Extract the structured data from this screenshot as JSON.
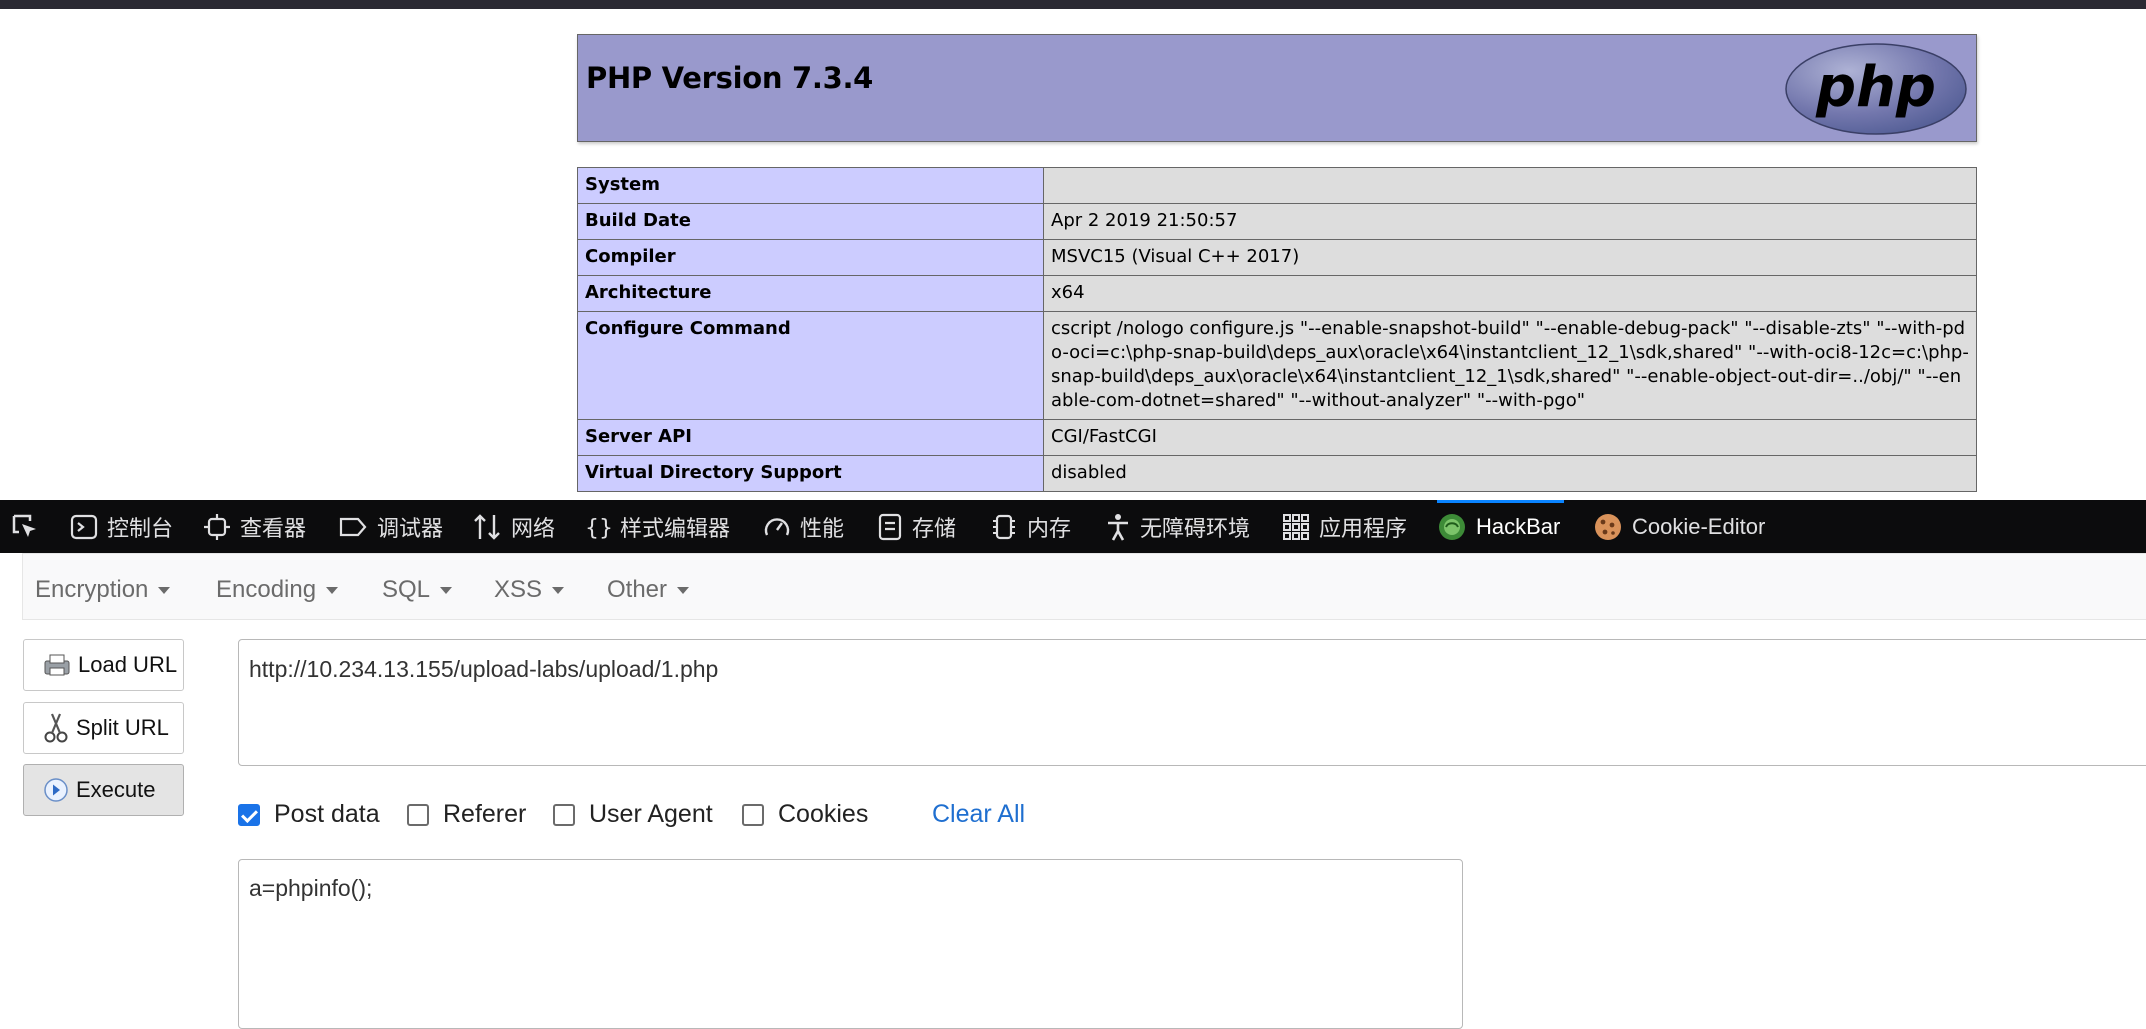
{
  "php": {
    "title": "PHP Version 7.3.4",
    "logo_text": "php",
    "rows": [
      {
        "key": "System",
        "value": ""
      },
      {
        "key": "Build Date",
        "value": "Apr 2 2019 21:50:57"
      },
      {
        "key": "Compiler",
        "value": "MSVC15 (Visual C++ 2017)"
      },
      {
        "key": "Architecture",
        "value": "x64"
      },
      {
        "key": "Configure Command",
        "value": "cscript /nologo configure.js \"--enable-snapshot-build\" \"--enable-debug-pack\" \"--disable-zts\" \"--with-pdo-oci=c:\\php-snap-build\\deps_aux\\oracle\\x64\\instantclient_12_1\\sdk,shared\" \"--with-oci8-12c=c:\\php-snap-build\\deps_aux\\oracle\\x64\\instantclient_12_1\\sdk,shared\" \"--enable-object-out-dir=../obj/\" \"--enable-com-dotnet=shared\" \"--without-analyzer\" \"--with-pgo\""
      },
      {
        "key": "Server API",
        "value": "CGI/FastCGI"
      },
      {
        "key": "Virtual Directory Support",
        "value": "disabled"
      }
    ]
  },
  "devtools": {
    "tabs": [
      {
        "label": "控制台",
        "icon": "console-icon"
      },
      {
        "label": "查看器",
        "icon": "inspector-icon"
      },
      {
        "label": "调试器",
        "icon": "debugger-icon"
      },
      {
        "label": "网络",
        "icon": "network-icon"
      },
      {
        "label": "样式编辑器",
        "icon": "style-editor-icon"
      },
      {
        "label": "性能",
        "icon": "performance-icon"
      },
      {
        "label": "存储",
        "icon": "storage-icon"
      },
      {
        "label": "内存",
        "icon": "memory-icon"
      },
      {
        "label": "无障碍环境",
        "icon": "accessibility-icon"
      },
      {
        "label": "应用程序",
        "icon": "application-icon"
      },
      {
        "label": "HackBar",
        "icon": "hackbar-icon"
      },
      {
        "label": "Cookie-Editor",
        "icon": "cookie-icon"
      }
    ],
    "active_tab": "HackBar",
    "accent": "#0a84ff"
  },
  "hackbar": {
    "menu": [
      "Encryption",
      "Encoding",
      "SQL",
      "XSS",
      "Other"
    ],
    "load_url": "Load URL",
    "split_url": "Split URL",
    "execute": "Execute",
    "url": "http://10.234.13.155/upload-labs/upload/1.php",
    "options": [
      {
        "label": "Post data",
        "checked": true
      },
      {
        "label": "Referer",
        "checked": false
      },
      {
        "label": "User Agent",
        "checked": false
      },
      {
        "label": "Cookies",
        "checked": false
      }
    ],
    "clear_all": "Clear All",
    "post_data": "a=phpinfo();"
  }
}
